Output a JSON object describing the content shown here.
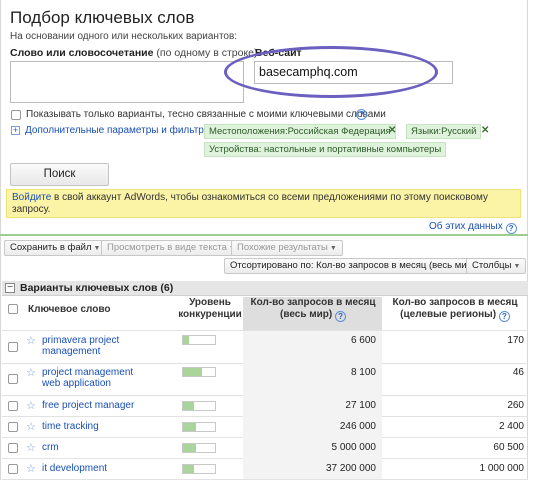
{
  "header": {
    "title": "Подбор ключевых слов",
    "subtitle": "На основании одного или нескольких вариантов:"
  },
  "form": {
    "keyword_label": "Слово или словосочетание",
    "keyword_hint": "(по одному в строке)",
    "keyword_value": "",
    "website_label": "Веб-сайт",
    "website_value": "basecamphq.com",
    "checkbox_label": "Показывать только варианты, тесно связанные с моими ключевыми словами",
    "advanced_link": "Дополнительные параметры и фильтры",
    "filters": [
      {
        "label": "Местоположения:Российская Федерация",
        "removable": true
      },
      {
        "label": "Языки:Русский",
        "removable": true
      },
      {
        "label": "Устройства: настольные и портативные компьютеры",
        "removable": false
      }
    ],
    "search_button": "Поиск",
    "remove_symbol": "✕",
    "help_symbol": "?"
  },
  "notice": {
    "link": "Войдите",
    "text": " в свой аккаунт AdWords, чтобы ознакомиться со всеми предложениями по этому поисковому запросу."
  },
  "data_link": "Об этих данных",
  "toolbar": {
    "save": "Сохранить в файл",
    "view_text": "Просмотреть в виде текста",
    "similar": "Похожие результаты",
    "sort": "Отсортировано по: Кол-во запросов в месяц (весь мир)",
    "columns": "Столбцы"
  },
  "group": {
    "title": "Варианты ключевых слов (6)"
  },
  "columns": {
    "keyword": "Ключевое слово",
    "competition": "Уровень конкуренции",
    "global": "Кол-во запросов в месяц (весь мир)",
    "local": "Кол-во запросов в месяц (целевые регионы)"
  },
  "rows": [
    {
      "keyword": "primavera project management",
      "competition": 0.2,
      "global": "6 600",
      "local": "170"
    },
    {
      "keyword": "project management web application",
      "competition": 0.6,
      "global": "8 100",
      "local": "46"
    },
    {
      "keyword": "free project manager",
      "competition": 0.35,
      "global": "27 100",
      "local": "260"
    },
    {
      "keyword": "time tracking",
      "competition": 0.4,
      "global": "246 000",
      "local": "2 400"
    },
    {
      "keyword": "crm",
      "competition": 0.4,
      "global": "5 000 000",
      "local": "60 500"
    },
    {
      "keyword": "it development",
      "competition": 0.35,
      "global": "37 200 000",
      "local": "1 000 000"
    }
  ],
  "colors": {
    "link": "#1a4fb5",
    "chip_bg": "#dff2dc",
    "notice_bg": "#fbf3a6",
    "oval": "#6b5fc0",
    "bar_fill": "#a9d59d"
  }
}
